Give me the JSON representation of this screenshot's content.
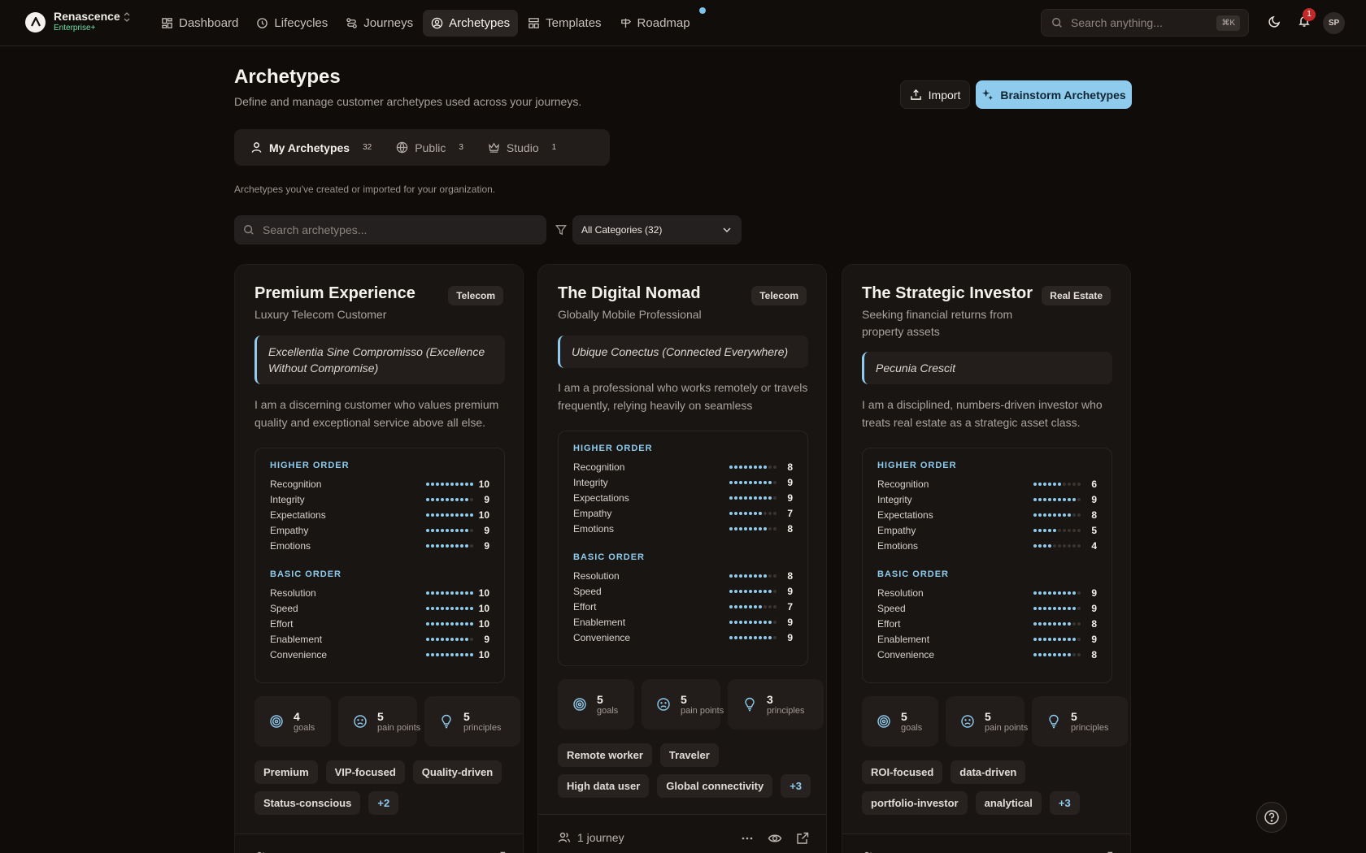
{
  "brand": {
    "name": "Renascence",
    "plan": "Enterprise+"
  },
  "nav": [
    {
      "label": "Dashboard",
      "icon": "dashboard-icon"
    },
    {
      "label": "Lifecycles",
      "icon": "lifecycle-icon"
    },
    {
      "label": "Journeys",
      "icon": "journeys-icon"
    },
    {
      "label": "Archetypes",
      "icon": "archetype-icon",
      "active": true
    },
    {
      "label": "Templates",
      "icon": "templates-icon"
    },
    {
      "label": "Roadmap",
      "icon": "roadmap-icon"
    }
  ],
  "search_all": {
    "placeholder": "Search anything...",
    "shortcut": "⌘K"
  },
  "notifications": {
    "count": "1"
  },
  "user": {
    "initials": "SP"
  },
  "header": {
    "title": "Archetypes",
    "subtitle": "Define and manage customer archetypes used across your journeys.",
    "import_label": "Import",
    "brainstorm_label": "Brainstorm Archetypes"
  },
  "tabs": [
    {
      "label": "My Archetypes",
      "count": "32"
    },
    {
      "label": "Public",
      "count": "3"
    },
    {
      "label": "Studio",
      "count": "1"
    }
  ],
  "tab_description": "Archetypes you've created or imported for your organization.",
  "search_archetypes": {
    "placeholder": "Search archetypes..."
  },
  "category_filter": {
    "selected": "All Categories (32)"
  },
  "colors": {
    "accent": "#8ecbed",
    "background": "#100c0a",
    "card": "#191513",
    "success": "#6fe3a8",
    "alert": "#c22a2a"
  },
  "cards": [
    {
      "title": "Premium Experience",
      "category": "Telecom",
      "subtitle": "Luxury Telecom Customer",
      "motto": "Excellentia Sine Compromisso (Excellence Without Compromise)",
      "description": "I am a discerning customer who values premium quality and exceptional service above all else.",
      "higher_title": "HIGHER ORDER",
      "higher": [
        {
          "label": "Recognition",
          "value": 10
        },
        {
          "label": "Integrity",
          "value": 9
        },
        {
          "label": "Expectations",
          "value": 10
        },
        {
          "label": "Empathy",
          "value": 9
        },
        {
          "label": "Emotions",
          "value": 9
        }
      ],
      "basic_title": "BASIC ORDER",
      "basic": [
        {
          "label": "Resolution",
          "value": 10
        },
        {
          "label": "Speed",
          "value": 10
        },
        {
          "label": "Effort",
          "value": 10
        },
        {
          "label": "Enablement",
          "value": 9
        },
        {
          "label": "Convenience",
          "value": 10
        }
      ],
      "stats": [
        {
          "num": "4",
          "label": "goals"
        },
        {
          "num": "5",
          "label": "pain points"
        },
        {
          "num": "5",
          "label": "principles"
        }
      ],
      "tags": [
        "Premium",
        "VIP-focused",
        "Quality-driven",
        "Status-conscious",
        "+2"
      ],
      "journeys": ""
    },
    {
      "title": "The Digital Nomad",
      "category": "Telecom",
      "subtitle": "Globally Mobile Professional",
      "motto": "Ubique Conectus (Connected Everywhere)",
      "description": "I am a professional who works remotely or travels frequently, relying heavily on seamless connectivity.",
      "higher_title": "HIGHER ORDER",
      "higher": [
        {
          "label": "Recognition",
          "value": 8
        },
        {
          "label": "Integrity",
          "value": 9
        },
        {
          "label": "Expectations",
          "value": 9
        },
        {
          "label": "Empathy",
          "value": 7
        },
        {
          "label": "Emotions",
          "value": 8
        }
      ],
      "basic_title": "BASIC ORDER",
      "basic": [
        {
          "label": "Resolution",
          "value": 8
        },
        {
          "label": "Speed",
          "value": 9
        },
        {
          "label": "Effort",
          "value": 7
        },
        {
          "label": "Enablement",
          "value": 9
        },
        {
          "label": "Convenience",
          "value": 9
        }
      ],
      "stats": [
        {
          "num": "5",
          "label": "goals"
        },
        {
          "num": "5",
          "label": "pain points"
        },
        {
          "num": "3",
          "label": "principles"
        }
      ],
      "tags": [
        "Remote worker",
        "Traveler",
        "High data user",
        "Global connectivity",
        "+3"
      ],
      "journeys": "1 journey"
    },
    {
      "title": "The Strategic Investor",
      "category": "Real Estate",
      "subtitle": "Seeking financial returns from property assets",
      "motto": "Pecunia Crescit",
      "description": "I am a disciplined, numbers-driven investor who treats real estate as a strategic asset class.",
      "higher_title": "HIGHER ORDER",
      "higher": [
        {
          "label": "Recognition",
          "value": 6
        },
        {
          "label": "Integrity",
          "value": 9
        },
        {
          "label": "Expectations",
          "value": 8
        },
        {
          "label": "Empathy",
          "value": 5
        },
        {
          "label": "Emotions",
          "value": 4
        }
      ],
      "basic_title": "BASIC ORDER",
      "basic": [
        {
          "label": "Resolution",
          "value": 9
        },
        {
          "label": "Speed",
          "value": 9
        },
        {
          "label": "Effort",
          "value": 8
        },
        {
          "label": "Enablement",
          "value": 9
        },
        {
          "label": "Convenience",
          "value": 8
        }
      ],
      "stats": [
        {
          "num": "5",
          "label": "goals"
        },
        {
          "num": "5",
          "label": "pain points"
        },
        {
          "num": "5",
          "label": "principles"
        }
      ],
      "tags": [
        "ROI-focused",
        "data-driven",
        "portfolio-investor",
        "analytical",
        "+3"
      ],
      "journeys": ""
    }
  ]
}
